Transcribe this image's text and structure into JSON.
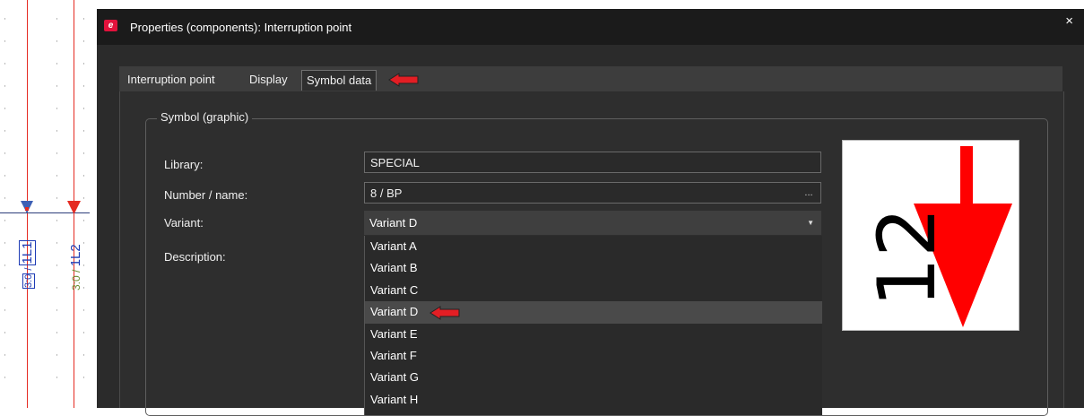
{
  "canvas": {
    "terminal_label_left": "1L1",
    "terminal_ref_left": "3:0",
    "terminal_ref_right": "3:0",
    "terminal_label_right": "1L2",
    "colors": {
      "wire_red": "#e52b22",
      "wire_blue": "#3d5fb5",
      "ref_green": "#6e8f34",
      "label_blue": "#1e3cb5"
    }
  },
  "dialog": {
    "title": "Properties (components): Interruption point",
    "app_icon": "eplan-logo-icon",
    "close_icon": "×",
    "tabs": [
      {
        "label": "Interruption point",
        "active": false
      },
      {
        "label": "Display",
        "active": false
      },
      {
        "label": "Symbol data",
        "active": true
      }
    ],
    "group_title": "Symbol (graphic)",
    "fields": {
      "library_label": "Library:",
      "library_value": "SPECIAL",
      "number_label": "Number / name:",
      "number_value": "8 / BP",
      "number_button": "...",
      "variant_label": "Variant:",
      "variant_value": "Variant D",
      "description_label": "Description:"
    },
    "variant_options": [
      "Variant A",
      "Variant B",
      "Variant C",
      "Variant D",
      "Variant E",
      "Variant F",
      "Variant G",
      "Variant H"
    ],
    "selected_option": "Variant D",
    "preview": {
      "text": "12",
      "arrow_color": "#ff0000"
    },
    "annotation_color": "#e31e24"
  }
}
